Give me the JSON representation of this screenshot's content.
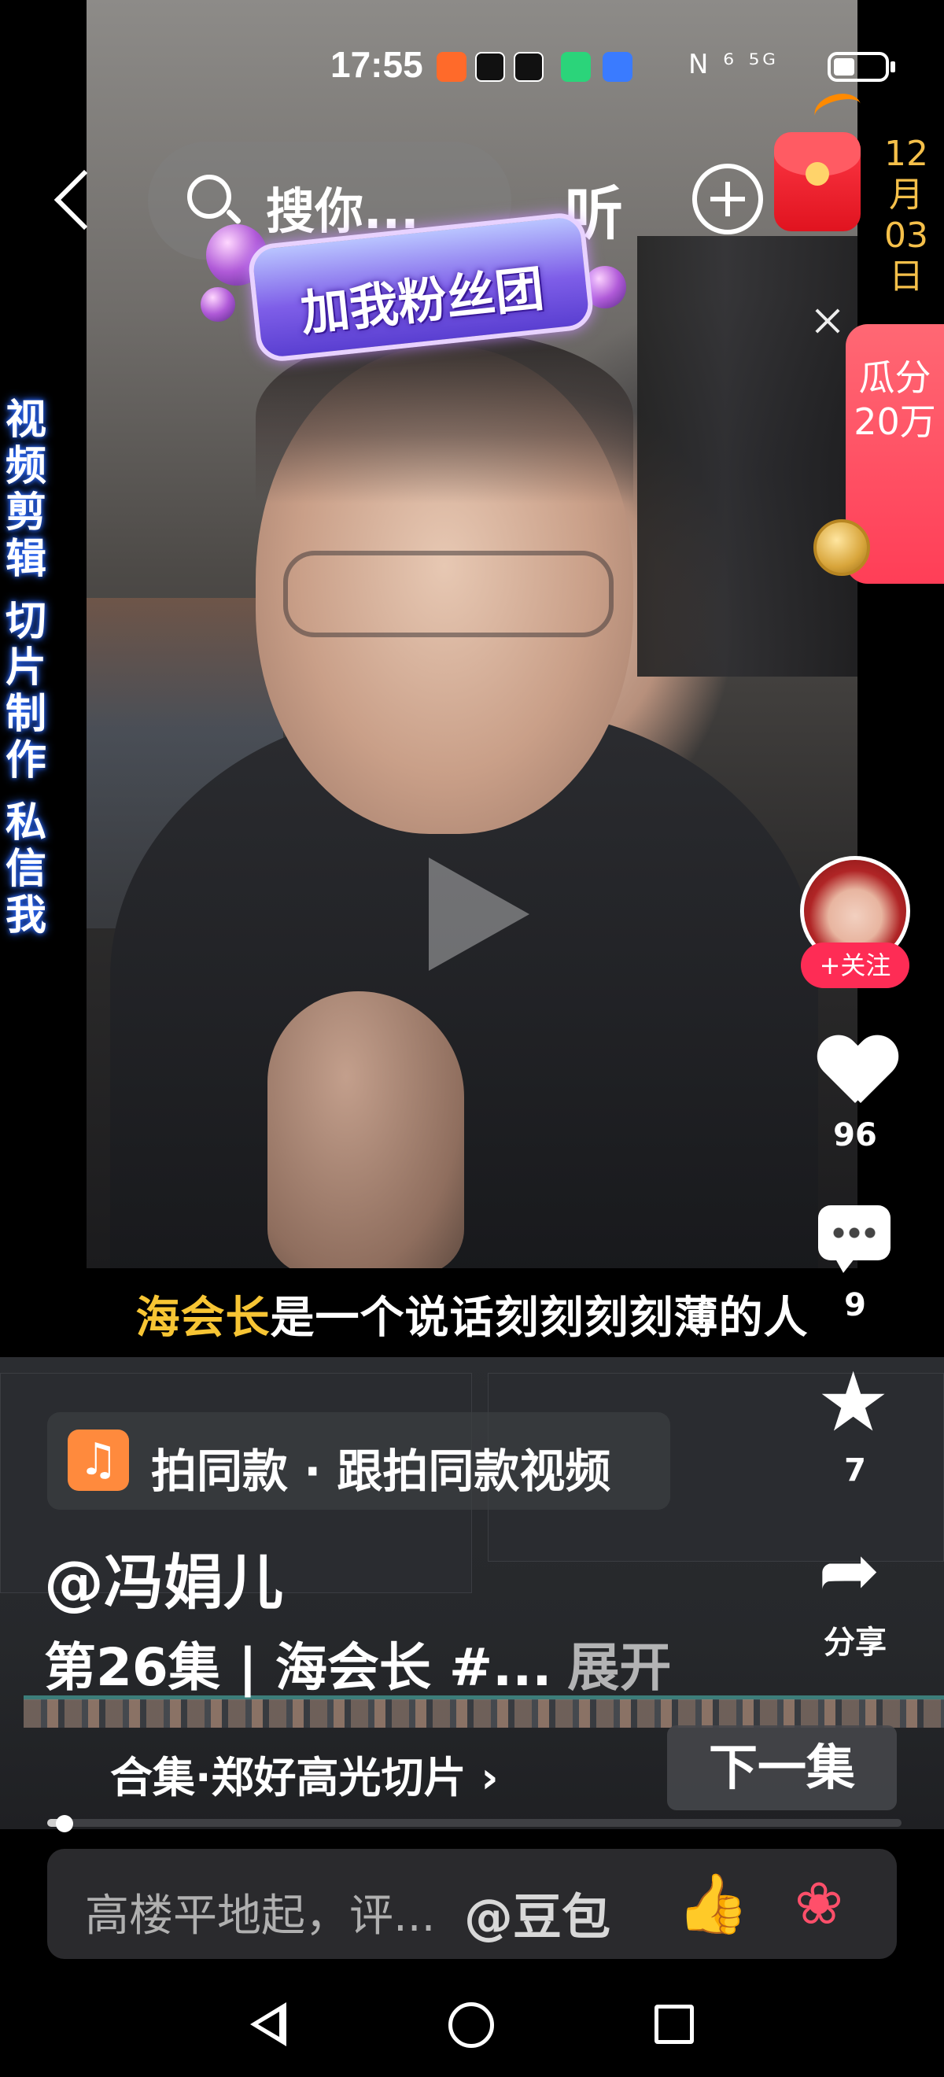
{
  "status_bar": {
    "time": "17:55",
    "right_indicators": "N ⁶ ⁵ᴳ"
  },
  "top_bar": {
    "search_text": "搜你...",
    "listen_label": "听"
  },
  "overlay": {
    "date_vertical": "12月03日",
    "fan_badge": "加我粉丝团",
    "promo_label": "瓜分20万",
    "side_text_lines": [
      "视",
      "频",
      "剪",
      "辑",
      "切",
      "片",
      "制",
      "作",
      "私",
      "信",
      "我"
    ]
  },
  "actions": {
    "follow_label": "+关注",
    "like_count": "96",
    "comment_count": "9",
    "favorite_count": "7",
    "share_label": "分享"
  },
  "subtitle": {
    "highlight": "海会长",
    "rest": "是一个说话刻刻刻刻薄的人"
  },
  "info": {
    "same_style": "拍同款 · 跟拍同款视频",
    "username": "@冯娟儿",
    "description": "第26集 | 海会长 #...",
    "expand_label": "展开",
    "collection": "合集·郑好高光切片 ›",
    "next_episode": "下一集",
    "progress": 0.02
  },
  "comment_bar": {
    "placeholder": "高楼平地起，评...",
    "mention": "@豆包"
  },
  "icons": [
    "back-icon",
    "search-icon",
    "add-icon",
    "red-packet-icon",
    "close-icon",
    "medal-icon",
    "play-icon",
    "heart-icon",
    "comment-icon",
    "star-icon",
    "share-icon",
    "music-icon",
    "layers-icon",
    "thumbs-up-icon",
    "rose-icon"
  ],
  "colors": {
    "accent": "#fe2c55",
    "subtitle_highlight": "#f7c534",
    "date": "#f5c04a"
  }
}
